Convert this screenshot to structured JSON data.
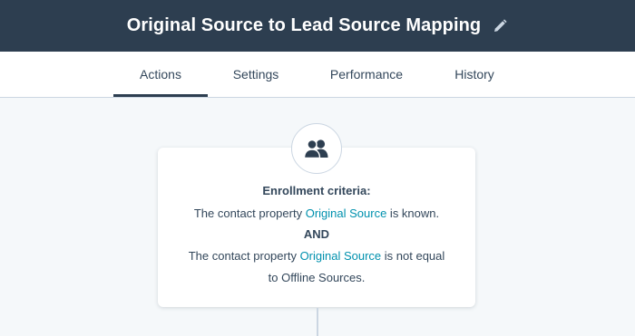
{
  "header": {
    "title": "Original Source to Lead Source Mapping",
    "edit_icon": "pencil-icon"
  },
  "tabs": [
    {
      "label": "Actions",
      "active": true
    },
    {
      "label": "Settings",
      "active": false
    },
    {
      "label": "Performance",
      "active": false
    },
    {
      "label": "History",
      "active": false
    }
  ],
  "enrollment": {
    "icon": "contacts-icon",
    "heading": "Enrollment criteria:",
    "criteria1": {
      "prefix": "The contact property ",
      "property": "Original Source",
      "suffix": " is known."
    },
    "joiner": "AND",
    "criteria2": {
      "prefix": "The contact property ",
      "property": "Original Source",
      "suffix": " is not equal",
      "line2": "to Offline Sources."
    }
  },
  "colors": {
    "header_bg": "#2d3e50",
    "link": "#0091ae",
    "text": "#33475b",
    "canvas_bg": "#f5f8fa"
  }
}
